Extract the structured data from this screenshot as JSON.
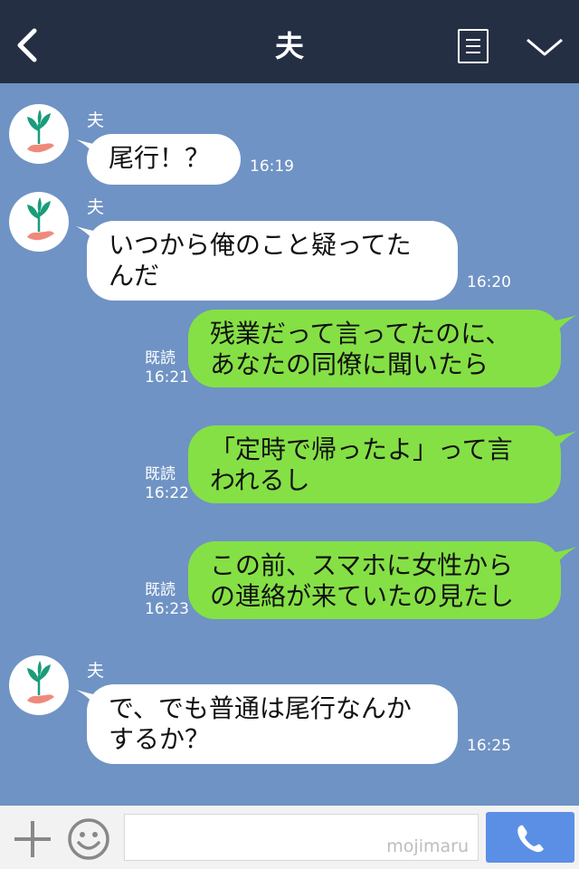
{
  "header": {
    "title": "夫"
  },
  "messages": [
    {
      "side": "left",
      "name": "夫",
      "lines": [
        "尾行！？"
      ],
      "time": "16:19"
    },
    {
      "side": "left",
      "name": "夫",
      "lines": [
        "いつから俺のこと疑ってた",
        "んだ"
      ],
      "time": "16:20"
    },
    {
      "side": "right",
      "read": "既読",
      "lines": [
        "残業だって言ってたのに、",
        "あなたの同僚に聞いたら"
      ],
      "time": "16:21"
    },
    {
      "side": "right",
      "read": "既読",
      "lines": [
        "「定時で帰ったよ」って言",
        "われるし"
      ],
      "time": "16:22"
    },
    {
      "side": "right",
      "read": "既読",
      "lines": [
        "この前、スマホに女性から",
        "の連絡が来ていたの見たし"
      ],
      "time": "16:23"
    },
    {
      "side": "left",
      "name": "夫",
      "lines": [
        "で、でも普通は尾行なんか",
        "するか？"
      ],
      "time": "16:25"
    }
  ],
  "input": {
    "watermark": "mojimaru"
  },
  "colors": {
    "header": "#252f44",
    "chat_bg": "#6f93c4",
    "right_bubble": "#85e045",
    "left_bubble": "#ffffff",
    "send_button": "#5b8fe6"
  },
  "icons": {
    "back": "chevron-left-icon",
    "menu": "menu-list-icon",
    "collapse": "chevron-down-icon",
    "plus": "plus-icon",
    "emoji": "smiley-icon",
    "send": "phone-icon"
  }
}
